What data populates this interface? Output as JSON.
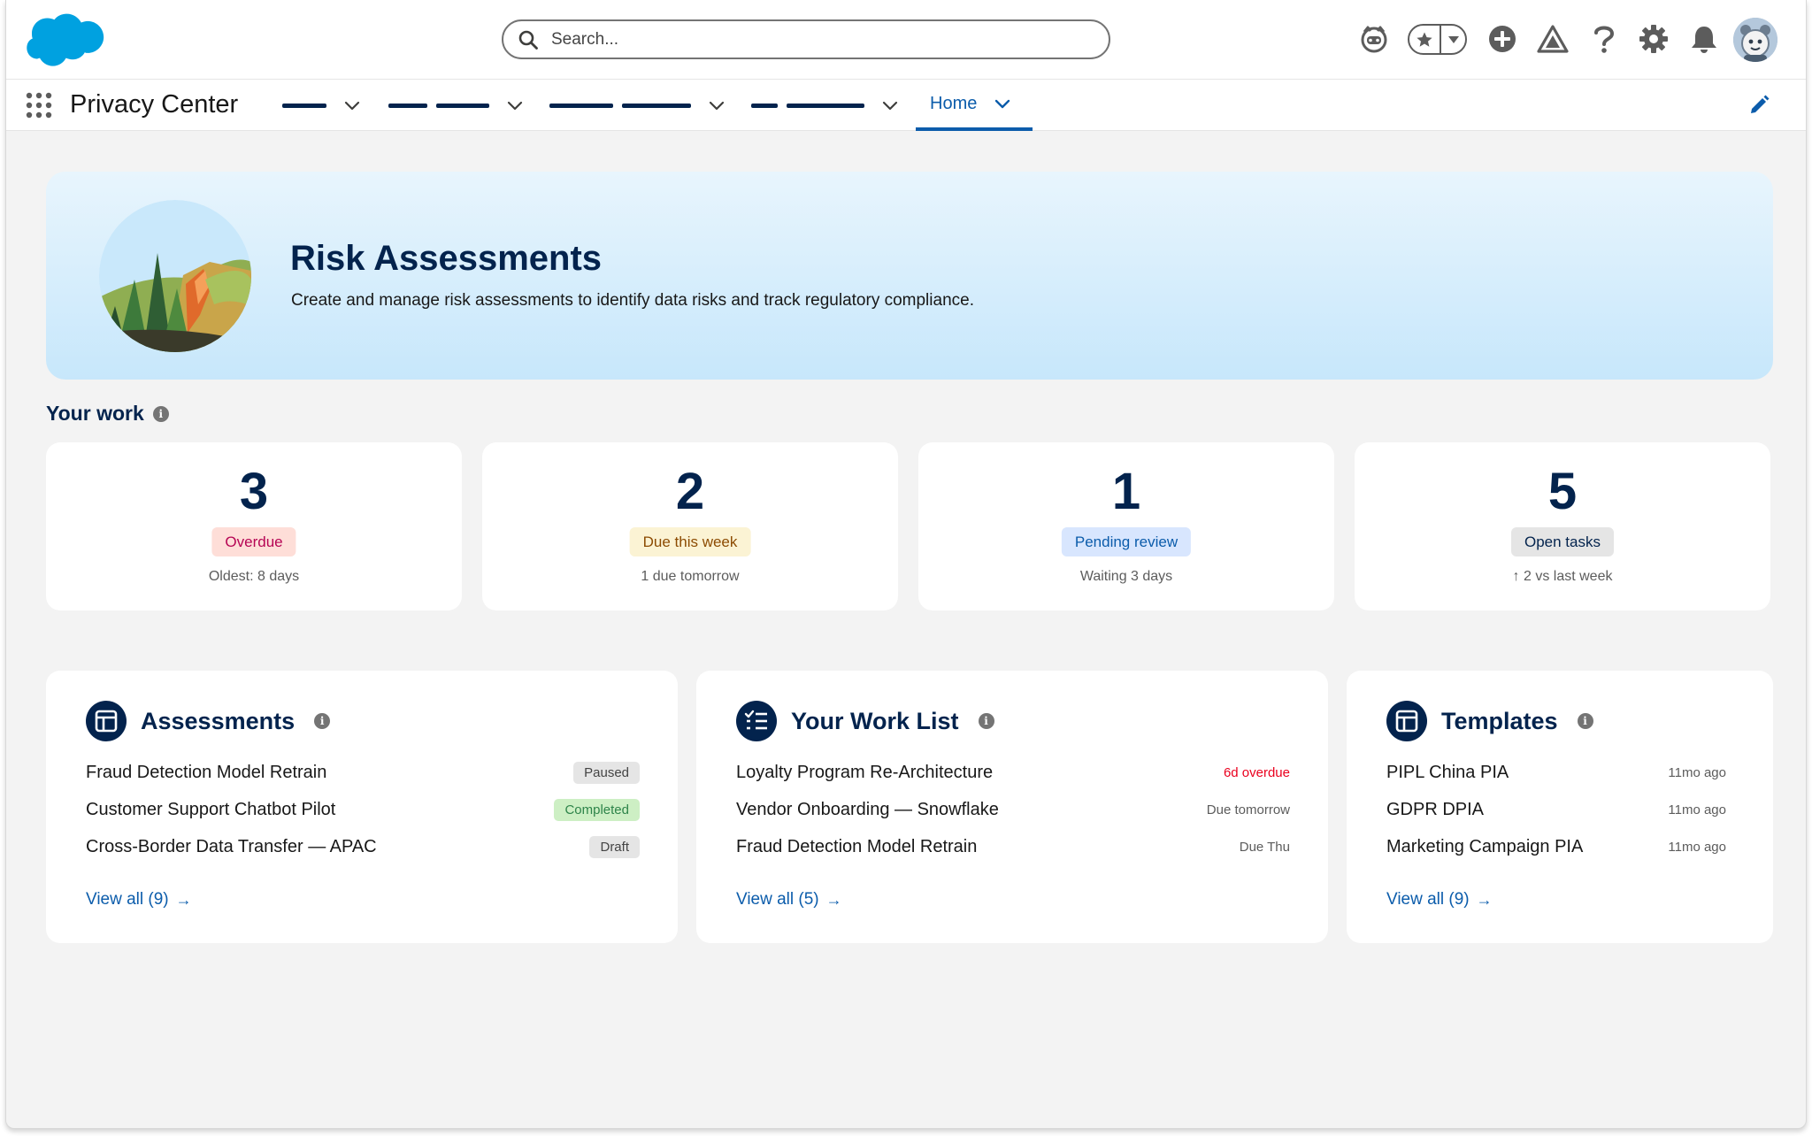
{
  "header": {
    "search_placeholder": "Search..."
  },
  "nav": {
    "app_name": "Privacy Center",
    "active_tab": "Home"
  },
  "banner": {
    "title": "Risk Assessments",
    "subtitle": "Create and manage risk assessments to identify data risks and track regulatory compliance."
  },
  "your_work": {
    "title": "Your work",
    "cards": [
      {
        "count": "3",
        "badge": "Overdue",
        "sub": "Oldest: 8 days"
      },
      {
        "count": "2",
        "badge": "Due this week",
        "sub": "1 due tomorrow"
      },
      {
        "count": "1",
        "badge": "Pending review",
        "sub": "Waiting 3 days"
      },
      {
        "count": "5",
        "badge": "Open tasks",
        "sub": "↑ 2 vs last week"
      }
    ]
  },
  "assessments": {
    "title": "Assessments",
    "rows": [
      {
        "label": "Fraud Detection Model Retrain",
        "status": "Paused"
      },
      {
        "label": "Customer Support Chatbot Pilot",
        "status": "Completed"
      },
      {
        "label": "Cross-Border Data Transfer — APAC",
        "status": "Draft"
      }
    ],
    "view_all": "View all (9)"
  },
  "work_list": {
    "title": "Your Work List",
    "rows": [
      {
        "label": "Loyalty Program Re-Architecture",
        "due": "6d overdue"
      },
      {
        "label": "Vendor Onboarding — Snowflake",
        "due": "Due tomorrow"
      },
      {
        "label": "Fraud Detection Model Retrain",
        "due": "Due Thu"
      }
    ],
    "view_all": "View all (5)"
  },
  "templates": {
    "title": "Templates",
    "rows": [
      {
        "label": "PIPL China PIA",
        "age": "11mo ago"
      },
      {
        "label": "GDPR DPIA",
        "age": "11mo ago"
      },
      {
        "label": "Marketing Campaign PIA",
        "age": "11mo ago"
      }
    ],
    "view_all": "View all (9)"
  },
  "colors": {
    "brand_blue": "#0b5cab",
    "navy": "#03234d",
    "overdue_bg": "#feded8",
    "overdue_text": "#b60554",
    "due_week_bg": "#fbf3d4",
    "due_week_text": "#8c4b02",
    "pending_bg": "#d8e6fe",
    "pending_text": "#0b5cab",
    "open_bg": "#e5e5e5",
    "completed_bg": "#cdefc4"
  }
}
